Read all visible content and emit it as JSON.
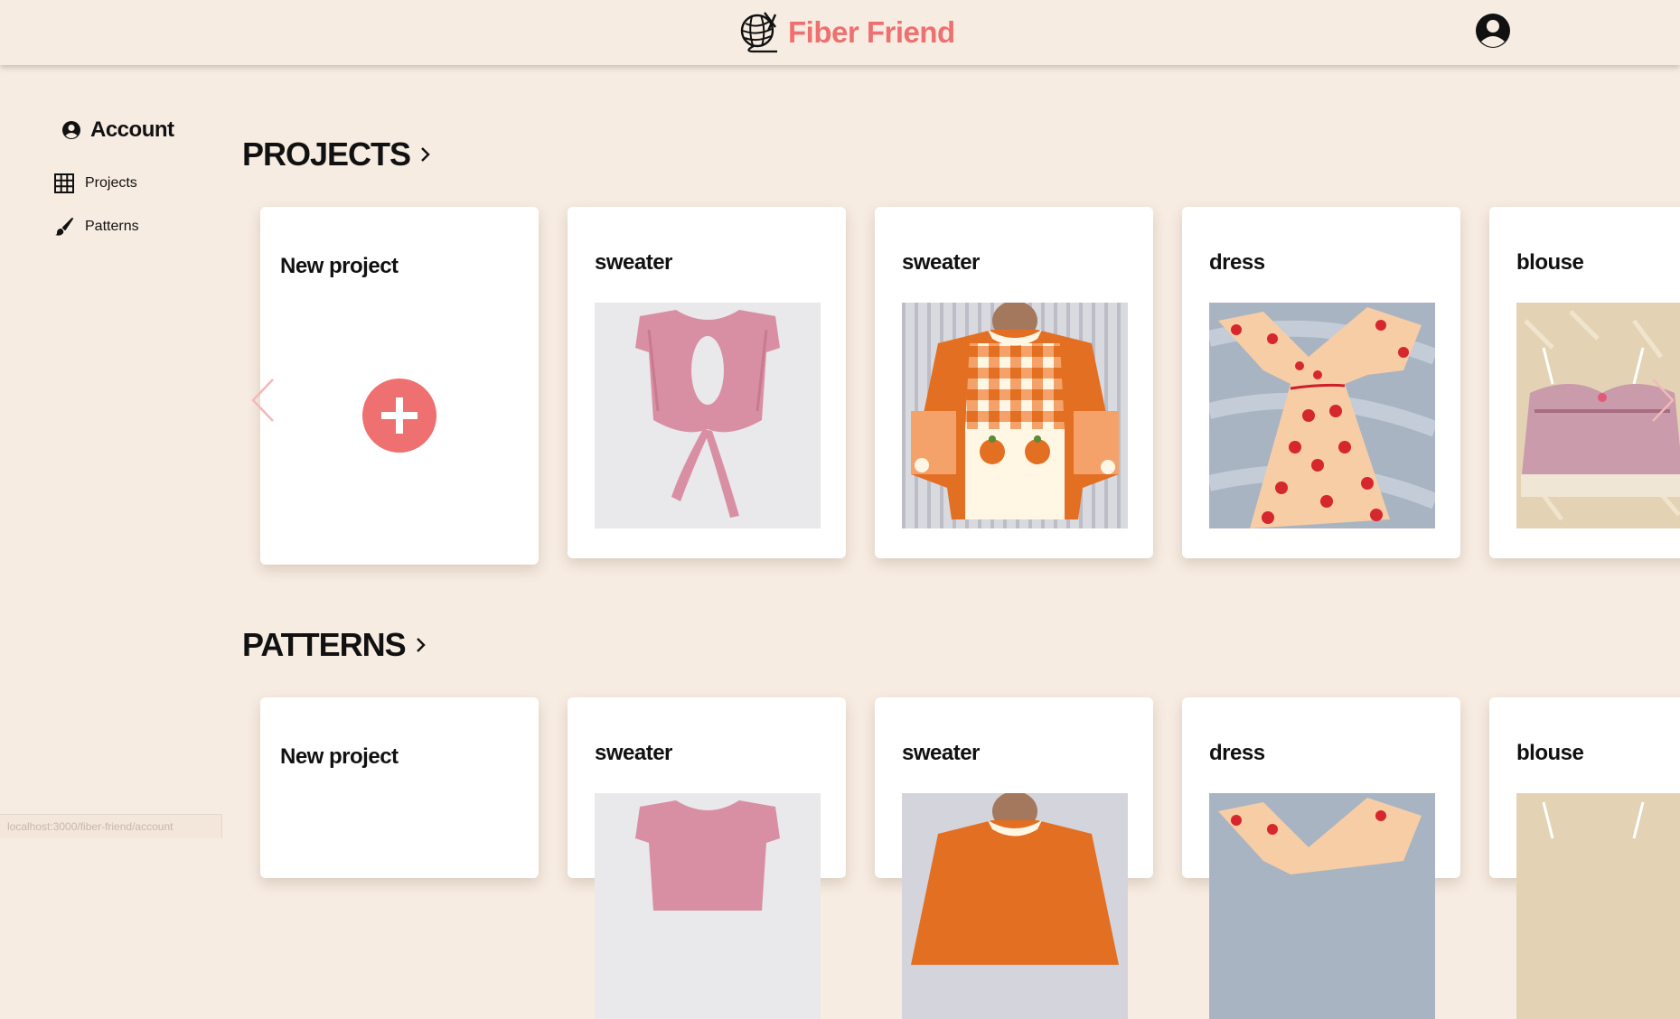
{
  "app": {
    "brand_name": "Fiber Friend",
    "brand_color": "#ee7070",
    "background_color": "#f7ece2"
  },
  "sidebar": {
    "account_label": "Account",
    "items": [
      {
        "label": "Projects",
        "icon": "grid-icon"
      },
      {
        "label": "Patterns",
        "icon": "brush-icon"
      }
    ]
  },
  "projects": {
    "title": "PROJECTS",
    "new_label": "New project",
    "cards": [
      {
        "title": "sweater"
      },
      {
        "title": "sweater"
      },
      {
        "title": "dress"
      },
      {
        "title": "blouse"
      }
    ]
  },
  "patterns": {
    "title": "PATTERNS",
    "new_label": "New project",
    "cards": [
      {
        "title": "sweater"
      },
      {
        "title": "sweater"
      },
      {
        "title": "dress"
      },
      {
        "title": "blouse"
      }
    ]
  },
  "status_bar": {
    "url": "localhost:3000/fiber-friend/account"
  }
}
